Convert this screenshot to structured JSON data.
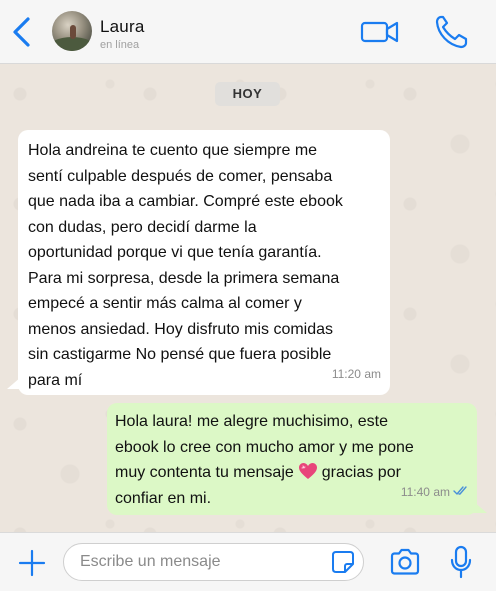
{
  "header": {
    "contact_name": "Laura",
    "status": "en línea",
    "icons": {
      "back": "chevron-left-icon",
      "video": "video-camera-icon",
      "call": "phone-icon"
    },
    "accent_color": "#1a7cf0"
  },
  "chat": {
    "date_label": "HOY",
    "messages": [
      {
        "direction": "incoming",
        "lines": [
          "Hola andreina te cuento que siempre me",
          "sentí culpable después de comer, pensaba",
          "que nada iba a cambiar. Compré este ebook",
          "con dudas, pero decidí darme la",
          "oportunidad porque vi que tenía garantía.",
          "Para mi sorpresa, desde la primera semana",
          "empecé a sentir más calma al comer y",
          "menos ansiedad. Hoy disfruto mis comidas",
          "sin castigarme No pensé que fuera posible",
          "para mí"
        ],
        "time": "11:20 am",
        "bubble_color": "#ffffff"
      },
      {
        "direction": "outgoing",
        "line1": "Hola laura! me alegre muchisimo, este",
        "line2": "ebook lo cree con mucho amor y me pone",
        "line3_before": "muy contenta tu mensaje",
        "line3_emoji": "sparkling-heart-icon",
        "line3_after": "gracias por",
        "line4": "confiar en mi.",
        "time": "11:40 am",
        "read_status": "double-check-icon",
        "bubble_color": "#dcf8c6"
      }
    ]
  },
  "input_bar": {
    "placeholder": "Escribe un mensaje",
    "icons": {
      "plus": "plus-icon",
      "sticker": "sticker-icon",
      "camera": "camera-icon",
      "mic": "microphone-icon"
    }
  }
}
